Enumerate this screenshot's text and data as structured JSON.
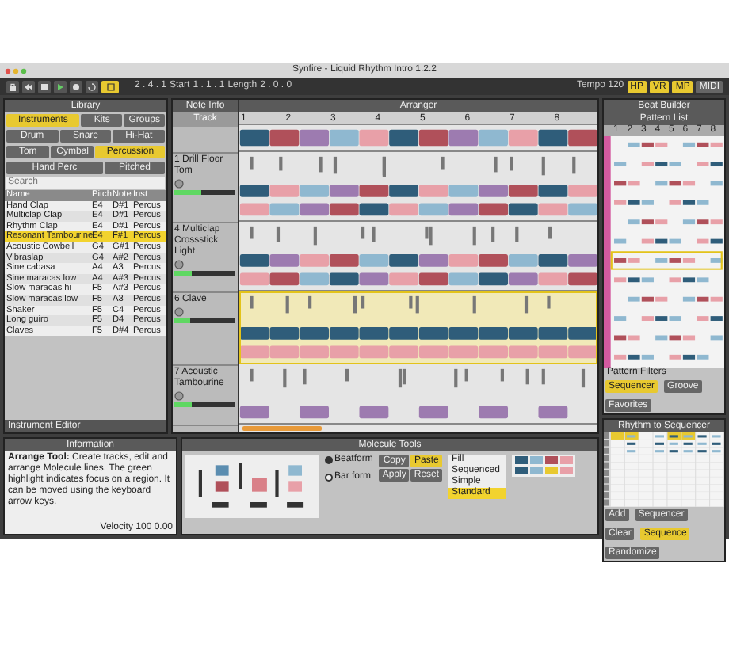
{
  "window": {
    "title": "Synfire - Liquid Rhythm Intro 1.2.2"
  },
  "toolbar": {
    "position": "2 . 4 . 1",
    "start_label": "Start",
    "start": "1 . 1 . 1",
    "length_label": "Length",
    "length": "2 . 0 . 0",
    "tempo": "Tempo 120",
    "modes": [
      {
        "label": "HP",
        "on": true
      },
      {
        "label": "VR",
        "on": true
      },
      {
        "label": "MP",
        "on": true
      },
      {
        "label": "MIDI",
        "on": false
      }
    ]
  },
  "library": {
    "title": "Library",
    "tabs": [
      {
        "label": "Instruments",
        "selected": true
      },
      {
        "label": "Kits",
        "selected": false
      },
      {
        "label": "Groups",
        "selected": false
      }
    ],
    "categories": [
      {
        "label": "Drum",
        "selected": false
      },
      {
        "label": "Snare",
        "selected": false
      },
      {
        "label": "Hi-Hat",
        "selected": false
      },
      {
        "label": "Tom",
        "selected": false
      },
      {
        "label": "Cymbal",
        "selected": false
      },
      {
        "label": "Percussion",
        "selected": true
      },
      {
        "label": "Hand Perc",
        "selected": false
      },
      {
        "label": "Pitched",
        "selected": false
      }
    ],
    "search_label": "Search",
    "columns": [
      "Name",
      "Pitch",
      "Note",
      "Inst"
    ],
    "rows": [
      {
        "cells": [
          "Hand Clap",
          "E4",
          "D#1",
          "Percus"
        ],
        "selected": false
      },
      {
        "cells": [
          "Multiclap Clap",
          "E4",
          "D#1",
          "Percus"
        ],
        "selected": false
      },
      {
        "cells": [
          "Rhythm Clap",
          "E4",
          "D#1",
          "Percus"
        ],
        "selected": false
      },
      {
        "cells": [
          "Resonant Tambourine",
          "E4",
          "F#1",
          "Percus"
        ],
        "selected": true
      },
      {
        "cells": [
          "Acoustic Cowbell",
          "G4",
          "G#1",
          "Percus"
        ],
        "selected": false
      },
      {
        "cells": [
          "Vibraslap",
          "G4",
          "A#2",
          "Percus"
        ],
        "selected": false
      },
      {
        "cells": [
          "Sine cabasa",
          "A4",
          "A3",
          "Percus"
        ],
        "selected": false
      },
      {
        "cells": [
          "Sine maracas low",
          "A4",
          "A#3",
          "Percus"
        ],
        "selected": false
      },
      {
        "cells": [
          "Slow maracas hi",
          "F5",
          "A#3",
          "Percus"
        ],
        "selected": false
      },
      {
        "cells": [
          "Slow maracas low",
          "F5",
          "A3",
          "Percus"
        ],
        "selected": false
      },
      {
        "cells": [
          "Shaker",
          "F5",
          "C4",
          "Percus"
        ],
        "selected": false
      },
      {
        "cells": [
          "Long guiro",
          "F5",
          "D4",
          "Percus"
        ],
        "selected": false
      },
      {
        "cells": [
          "Claves",
          "F5",
          "D#4",
          "Percus"
        ],
        "selected": false
      }
    ],
    "footer": "Instrument Editor"
  },
  "note_panel": {
    "title": "Note Info",
    "track_label": "Track"
  },
  "arranger": {
    "title": "Arranger",
    "ruler": [
      "1",
      "2",
      "3",
      "4",
      "5",
      "6",
      "7",
      "8"
    ],
    "tracks": [
      {
        "name": "1 Drill Floor Tom",
        "level": 0.45,
        "selected": false
      },
      {
        "name": "4 Multiclap Crossstick Light",
        "level": 0.3,
        "selected": false
      },
      {
        "name": "6 Clave",
        "level": 0.25,
        "selected": true
      },
      {
        "name": "7 Acoustic Tambourine",
        "level": 0.3,
        "selected": false
      }
    ]
  },
  "information": {
    "title": "Information",
    "heading": "Arrange Tool:",
    "text": "Create tracks, edit and arrange Molecule lines. The green highlight indicates focus on a region. It can be moved using the keyboard arrow keys.",
    "link": "Velocity 100 0.00"
  },
  "molecule_tools": {
    "title": "Molecule Tools",
    "options": [
      {
        "label": "Beatform",
        "selected": true
      },
      {
        "label": "Bar form",
        "selected": false
      }
    ],
    "buttons": [
      {
        "label": "Copy",
        "on": false
      },
      {
        "label": "Paste",
        "on": true
      },
      {
        "label": "Apply",
        "on": false
      },
      {
        "label": "Reset",
        "on": false
      }
    ],
    "lists": [
      {
        "label": "Fill",
        "selected": false
      },
      {
        "label": "Sequenced",
        "selected": false
      },
      {
        "label": "Simple",
        "selected": false
      },
      {
        "label": "Standard",
        "selected": true
      }
    ]
  },
  "beat_builder": {
    "title": "Beat Builder",
    "list_title": "Pattern List",
    "columns": [
      "1",
      "2",
      "3",
      "4",
      "5",
      "6",
      "7",
      "8"
    ],
    "filters_label": "Pattern Filters",
    "filters": [
      {
        "label": "Sequencer",
        "selected": true
      },
      {
        "label": "Groove",
        "selected": false
      },
      {
        "label": "Favorites",
        "selected": false
      }
    ],
    "sequencer_title": "Rhythm to Sequencer",
    "actions": [
      {
        "label": "Add",
        "on": false
      },
      {
        "label": "Sequencer",
        "on": false
      },
      {
        "label": "Clear",
        "on": false
      },
      {
        "label": "Sequence",
        "on": true
      },
      {
        "label": "Randomize",
        "on": false
      }
    ]
  }
}
